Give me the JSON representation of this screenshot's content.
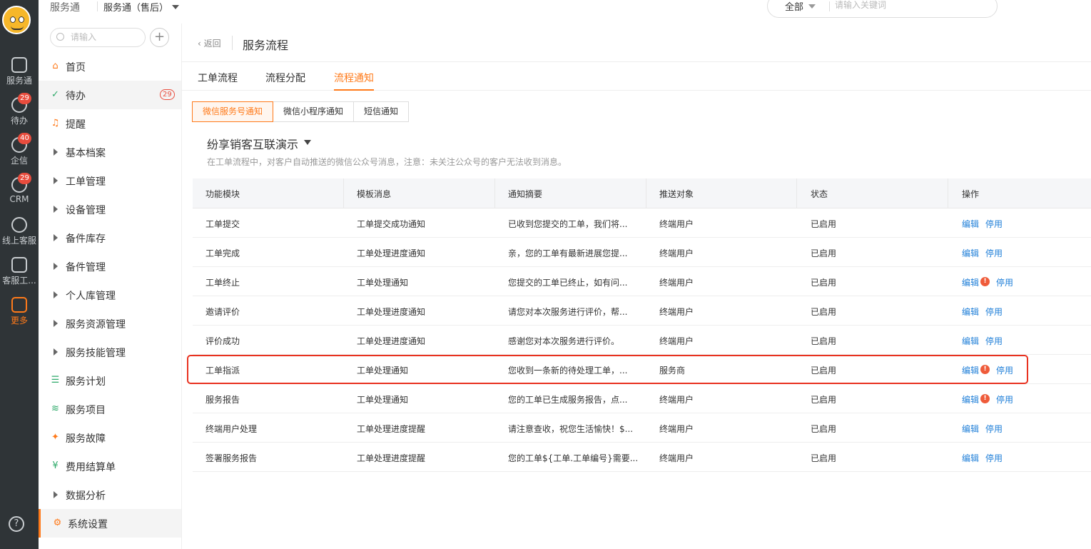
{
  "rail": {
    "items": [
      {
        "label": "服务通",
        "icon": "service-icon"
      },
      {
        "label": "待办",
        "icon": "check-circle-icon",
        "badge": "29"
      },
      {
        "label": "企信",
        "icon": "chat-icon",
        "badge": "40"
      },
      {
        "label": "CRM",
        "icon": "clock-icon",
        "badge": "29"
      },
      {
        "label": "线上客服",
        "icon": "smile-icon"
      },
      {
        "label": "客服工...",
        "icon": "headset-icon"
      },
      {
        "label": "更多",
        "icon": "grid-icon",
        "active": true
      }
    ],
    "help": "?"
  },
  "topbar": {
    "brand": "服务通",
    "org": "服务通（售后）",
    "scope": "全部",
    "search_placeholder": "请输入关键词"
  },
  "sidebar": {
    "search_placeholder": "请输入",
    "add": "+",
    "items": [
      {
        "label": "首页",
        "icon": "home-icon"
      },
      {
        "label": "待办",
        "icon": "check-circle-icon",
        "badge": "29"
      },
      {
        "label": "提醒",
        "icon": "bell-icon"
      },
      {
        "label": "基本档案",
        "icon": "caret-right-icon"
      },
      {
        "label": "工单管理",
        "icon": "caret-right-icon"
      },
      {
        "label": "设备管理",
        "icon": "caret-right-icon"
      },
      {
        "label": "备件库存",
        "icon": "caret-right-icon"
      },
      {
        "label": "备件管理",
        "icon": "caret-right-icon"
      },
      {
        "label": "个人库管理",
        "icon": "caret-right-icon"
      },
      {
        "label": "服务资源管理",
        "icon": "caret-right-icon"
      },
      {
        "label": "服务技能管理",
        "icon": "caret-right-icon"
      },
      {
        "label": "服务计划",
        "icon": "list-icon"
      },
      {
        "label": "服务项目",
        "icon": "layers-icon"
      },
      {
        "label": "服务故障",
        "icon": "bulb-icon"
      },
      {
        "label": "费用结算单",
        "icon": "receipt-icon"
      },
      {
        "label": "数据分析",
        "icon": "caret-right-icon"
      },
      {
        "label": "系统设置",
        "icon": "gear-icon"
      }
    ]
  },
  "main": {
    "back": "返回",
    "title": "服务流程",
    "tabs": [
      "工单流程",
      "流程分配",
      "流程通知"
    ],
    "subtabs": [
      "微信服务号通知",
      "微信小程序通知",
      "短信通知"
    ],
    "account": "纷享销客互联演示",
    "hint": "在工单流程中，对客户自动推送的微信公众号消息，注意：未关注公众号的客户无法收到消息。",
    "columns": [
      "功能模块",
      "模板消息",
      "通知摘要",
      "推送对象",
      "状态",
      "操作"
    ],
    "edit_label": "编辑",
    "disable_label": "停用",
    "rows": [
      {
        "module": "工单提交",
        "template": "工单提交成功通知",
        "summary": "已收到您提交的工单，我们将...",
        "target": "终端用户",
        "status": "已启用",
        "warn": false
      },
      {
        "module": "工单完成",
        "template": "工单处理进度通知",
        "summary": "亲，您的工单有最新进展您提...",
        "target": "终端用户",
        "status": "已启用",
        "warn": false
      },
      {
        "module": "工单终止",
        "template": "工单处理通知",
        "summary": "您提交的工单已终止，如有问...",
        "target": "终端用户",
        "status": "已启用",
        "warn": true
      },
      {
        "module": "邀请评价",
        "template": "工单处理进度通知",
        "summary": "请您对本次服务进行评价，帮...",
        "target": "终端用户",
        "status": "已启用",
        "warn": false
      },
      {
        "module": "评价成功",
        "template": "工单处理进度通知",
        "summary": "感谢您对本次服务进行评价。",
        "target": "终端用户",
        "status": "已启用",
        "warn": false
      },
      {
        "module": "工单指派",
        "template": "工单处理通知",
        "summary": "您收到一条新的待处理工单，...",
        "target": "服务商",
        "status": "已启用",
        "warn": true
      },
      {
        "module": "服务报告",
        "template": "工单处理通知",
        "summary": "您的工单已生成服务报告，点...",
        "target": "终端用户",
        "status": "已启用",
        "warn": true
      },
      {
        "module": "终端用户处理",
        "template": "工单处理进度提醒",
        "summary": "请注意查收，祝您生活愉快！$...",
        "target": "终端用户",
        "status": "已启用",
        "warn": false
      },
      {
        "module": "签署服务报告",
        "template": "工单处理进度提醒",
        "summary": "您的工单${工单.工单编号}需要...",
        "target": "终端用户",
        "status": "已启用",
        "warn": false
      }
    ]
  },
  "colors": {
    "accent": "#ff7a1a",
    "link": "#1f7fd8",
    "highlight": "#e8311f"
  }
}
